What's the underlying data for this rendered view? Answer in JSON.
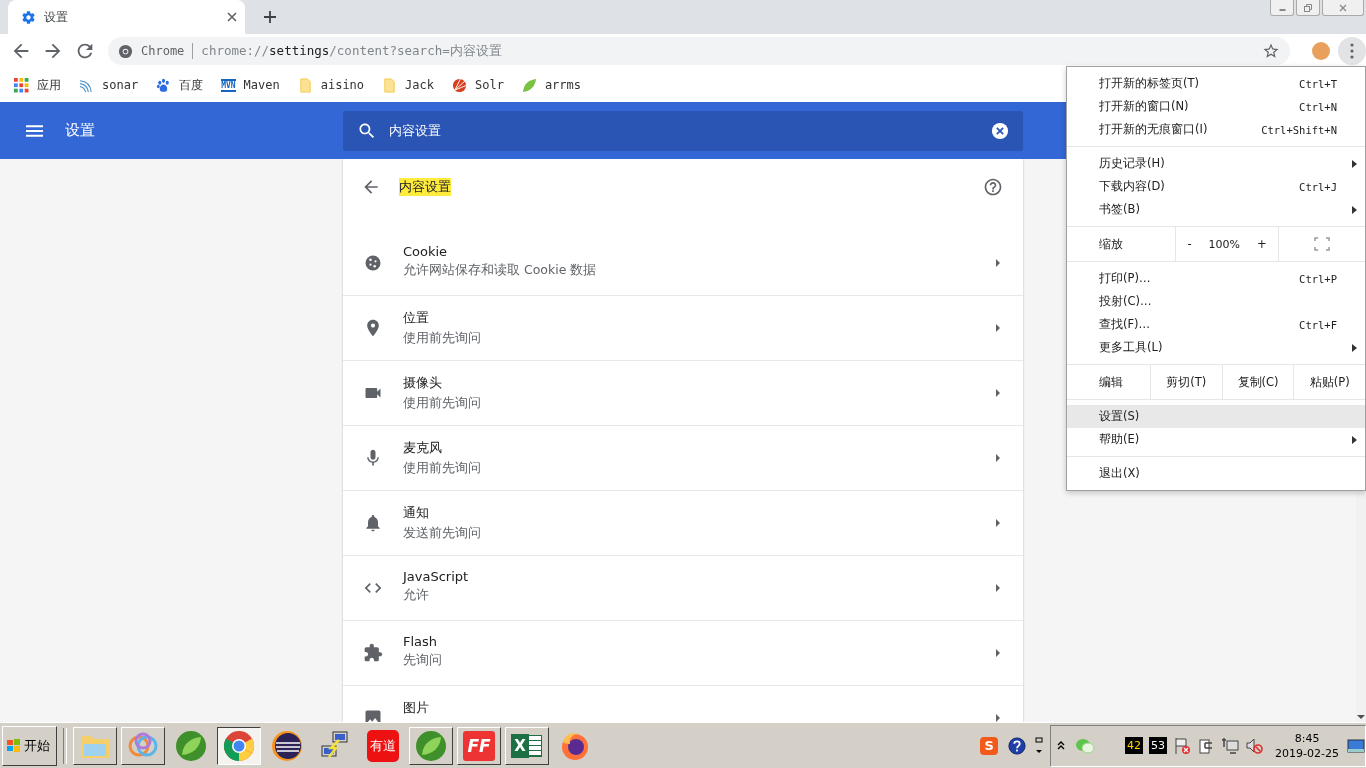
{
  "tabs": [
    {
      "title": "设置",
      "selected": true
    }
  ],
  "address_bar": {
    "site_label": "Chrome",
    "url": "chrome://**settings**/content?search=内容设置"
  },
  "bookmarks": [
    {
      "label": "应用",
      "kind": "apps"
    },
    {
      "label": "sonar",
      "kind": "sonar"
    },
    {
      "label": "百度",
      "kind": "paw"
    },
    {
      "label": "Maven",
      "kind": "maven",
      "icon_text": "MVN"
    },
    {
      "label": "aisino",
      "kind": "folder"
    },
    {
      "label": "Jack",
      "kind": "folder"
    },
    {
      "label": "Solr",
      "kind": "solr"
    },
    {
      "label": "arrms",
      "kind": "leaf"
    }
  ],
  "settings_header": {
    "title": "设置",
    "search_value": "内容设置"
  },
  "panel": {
    "title": "内容设置",
    "items": [
      {
        "kind": "cookie",
        "title": "Cookie",
        "subtitle": "允许网站保存和读取 Cookie 数据"
      },
      {
        "kind": "location",
        "title": "位置",
        "subtitle": "使用前先询问"
      },
      {
        "kind": "camera",
        "title": "摄像头",
        "subtitle": "使用前先询问"
      },
      {
        "kind": "mic",
        "title": "麦克风",
        "subtitle": "使用前先询问"
      },
      {
        "kind": "bell",
        "title": "通知",
        "subtitle": "发送前先询问"
      },
      {
        "kind": "code",
        "title": "JavaScript",
        "subtitle": "允许"
      },
      {
        "kind": "puzzle",
        "title": "Flash",
        "subtitle": "先询问"
      },
      {
        "kind": "image",
        "title": "图片"
      }
    ]
  },
  "menu": {
    "sections": [
      [
        {
          "kind": "item",
          "label": "打开新的标签页(T)",
          "shortcut": "Ctrl+T",
          "submenu": false,
          "selected": false
        },
        {
          "kind": "item",
          "label": "打开新的窗口(N)",
          "shortcut": "Ctrl+N",
          "submenu": false,
          "selected": false
        },
        {
          "kind": "item",
          "label": "打开新的无痕窗口(I)",
          "shortcut": "Ctrl+Shift+N",
          "submenu": false,
          "selected": false
        }
      ],
      [
        {
          "kind": "item",
          "label": "历史记录(H)",
          "submenu": true,
          "selected": false
        },
        {
          "kind": "item",
          "label": "下载内容(D)",
          "shortcut": "Ctrl+J",
          "submenu": false,
          "selected": false
        },
        {
          "kind": "item",
          "label": "书签(B)",
          "submenu": true,
          "selected": false
        }
      ],
      [
        {
          "kind": "zoom",
          "label": "缩放",
          "minus": "-",
          "value": "100%",
          "plus": "+"
        }
      ],
      [
        {
          "kind": "item",
          "label": "打印(P)…",
          "shortcut": "Ctrl+P",
          "submenu": false,
          "selected": false
        },
        {
          "kind": "item",
          "label": "投射(C)…",
          "submenu": false,
          "selected": false
        },
        {
          "kind": "item",
          "label": "查找(F)…",
          "shortcut": "Ctrl+F",
          "submenu": false,
          "selected": false
        },
        {
          "kind": "item",
          "label": "更多工具(L)",
          "submenu": true,
          "selected": false
        }
      ],
      [
        {
          "kind": "edit",
          "label": "编辑",
          "actions": [
            "剪切(T)",
            "复制(C)",
            "粘贴(P)"
          ]
        }
      ],
      [
        {
          "kind": "item",
          "label": "设置(S)",
          "submenu": false,
          "selected": true
        },
        {
          "kind": "item",
          "label": "帮助(E)",
          "submenu": true,
          "selected": false
        }
      ],
      [
        {
          "kind": "item",
          "label": "退出(X)",
          "submenu": false,
          "selected": false
        }
      ]
    ]
  },
  "taskbar": {
    "start": "开始",
    "apps": [
      {
        "kind": "folder",
        "open": true,
        "selected": false
      },
      {
        "kind": "rings",
        "open": true,
        "selected": false
      },
      {
        "kind": "leaf",
        "open": false,
        "selected": false
      },
      {
        "kind": "chrome",
        "open": true,
        "selected": true
      },
      {
        "kind": "eclipse",
        "open": false,
        "selected": false
      },
      {
        "kind": "network",
        "open": false,
        "selected": false
      },
      {
        "kind": "youdao",
        "label": "有道",
        "open": false,
        "selected": false
      },
      {
        "kind": "leaf",
        "open": true,
        "selected": false
      },
      {
        "kind": "ff",
        "label": "FF",
        "open": true,
        "selected": false
      },
      {
        "kind": "excel",
        "label": "X",
        "open": true,
        "selected": false
      },
      {
        "kind": "firefox",
        "open": false,
        "selected": false
      }
    ],
    "tray": {
      "ime_label": "S",
      "counters": [
        "42",
        "53"
      ],
      "time": "8:45",
      "date": "2019-02-25"
    }
  }
}
